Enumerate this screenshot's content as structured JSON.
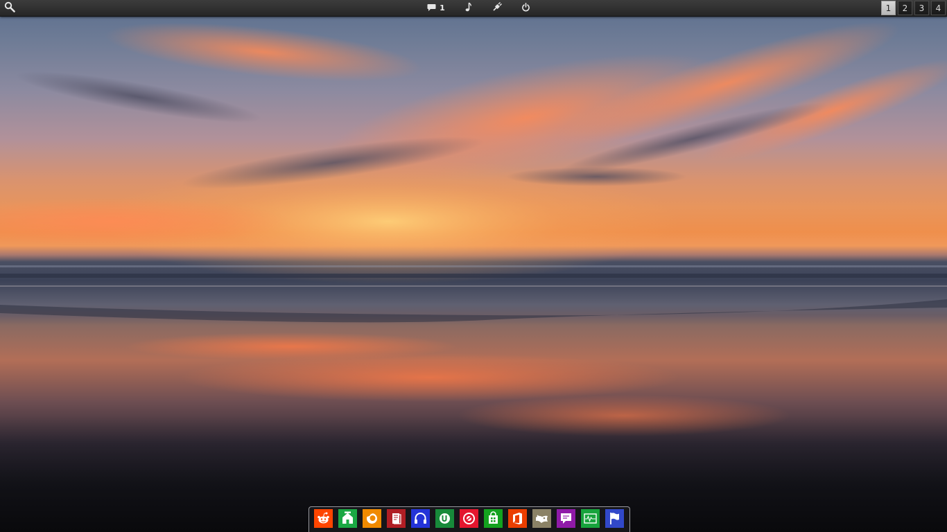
{
  "top_panel": {
    "search_icon": "search-icon",
    "notifications": {
      "icon": "chat-bubble-icon",
      "count": "1"
    },
    "music_icon": "music-note-icon",
    "network_icon": "network-plug-icon",
    "power_icon": "power-icon"
  },
  "workspaces": {
    "items": [
      "1",
      "2",
      "3",
      "4"
    ],
    "active": "1"
  },
  "dock": {
    "items": [
      {
        "icon": "reddit-icon",
        "color": "#ff4500"
      },
      {
        "icon": "store-home-icon",
        "color": "#1aa843"
      },
      {
        "icon": "firefox-icon",
        "color": "#f08a00"
      },
      {
        "icon": "reader-icon",
        "color": "#b01e24"
      },
      {
        "icon": "headphones-icon",
        "color": "#2433d8"
      },
      {
        "icon": "torrent-icon",
        "color": "#178a3a"
      },
      {
        "icon": "radio-icon",
        "color": "#e3162e"
      },
      {
        "icon": "shopping-bag-icon",
        "color": "#14a21f"
      },
      {
        "icon": "office-icon",
        "color": "#ea3e00"
      },
      {
        "icon": "gimp-icon",
        "color": "#8b8266"
      },
      {
        "icon": "chat-icon",
        "color": "#8f1aa8"
      },
      {
        "icon": "system-monitor-icon",
        "color": "#17a33c"
      },
      {
        "icon": "flag-icon",
        "color": "#3148c9"
      }
    ]
  }
}
